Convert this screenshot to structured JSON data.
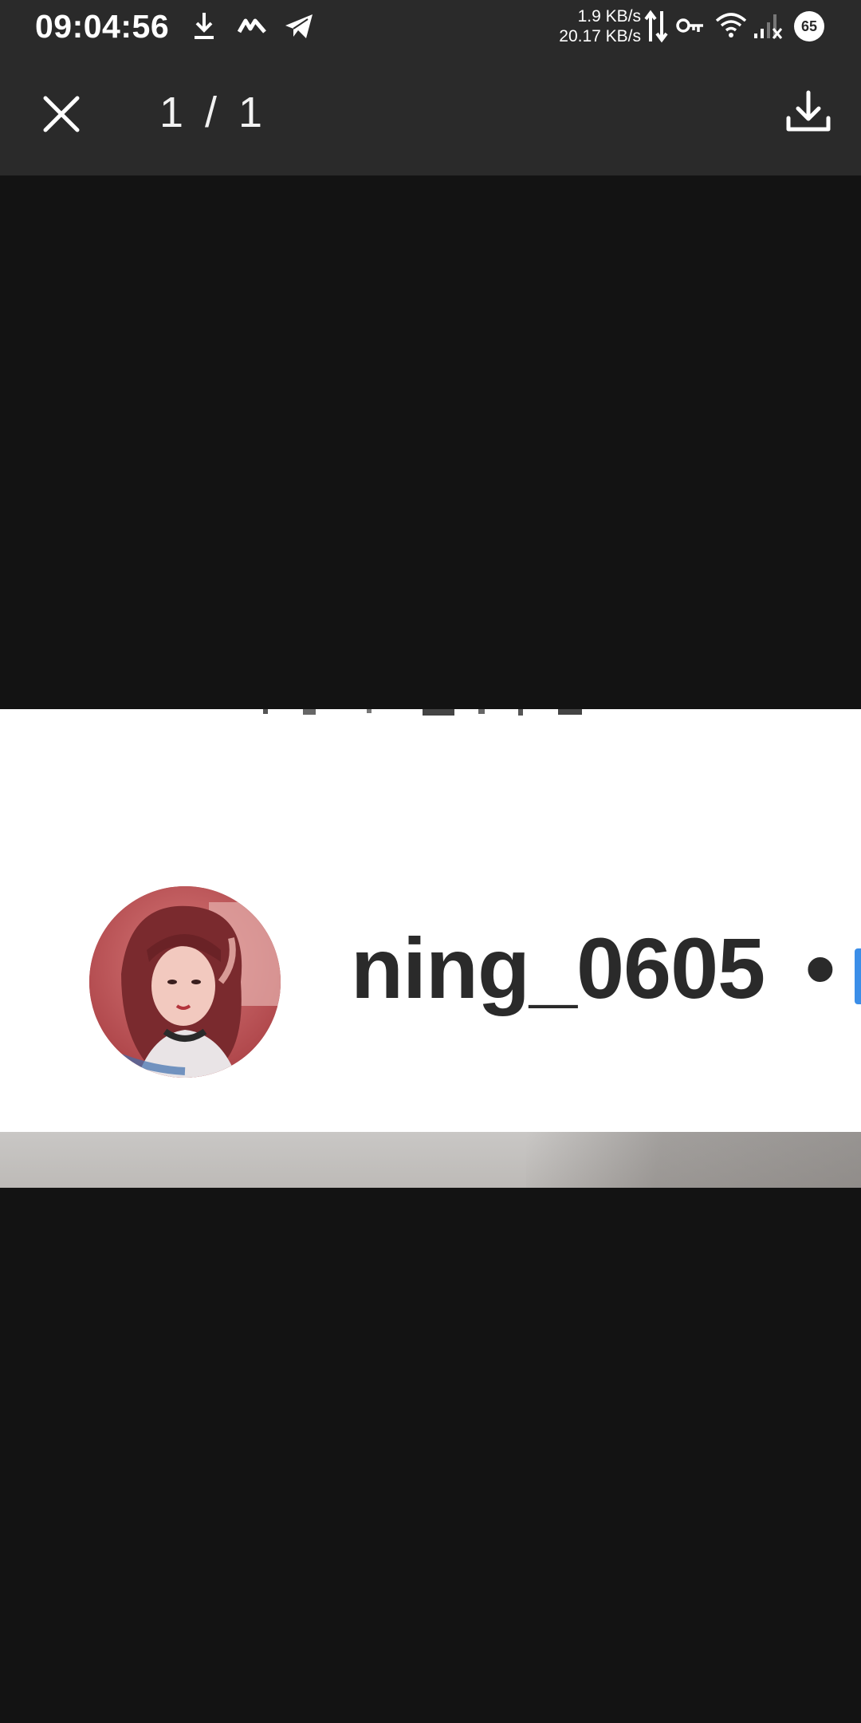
{
  "status_bar": {
    "time": "09:04:56",
    "net_up": "1.9 KB/s",
    "net_down": "20.17 KB/s",
    "battery": "65",
    "icons": [
      "download-icon",
      "app-icon",
      "telegram-icon",
      "updown-arrows-icon",
      "key-icon",
      "wifi-icon",
      "signal-icon",
      "battery-icon"
    ]
  },
  "top_bar": {
    "counter": "1 / 1",
    "close_icon": "close-icon",
    "download_icon": "download-icon"
  },
  "photo": {
    "username": "ning_0605",
    "separator": "•",
    "avatar_icon": "profile-photo"
  }
}
